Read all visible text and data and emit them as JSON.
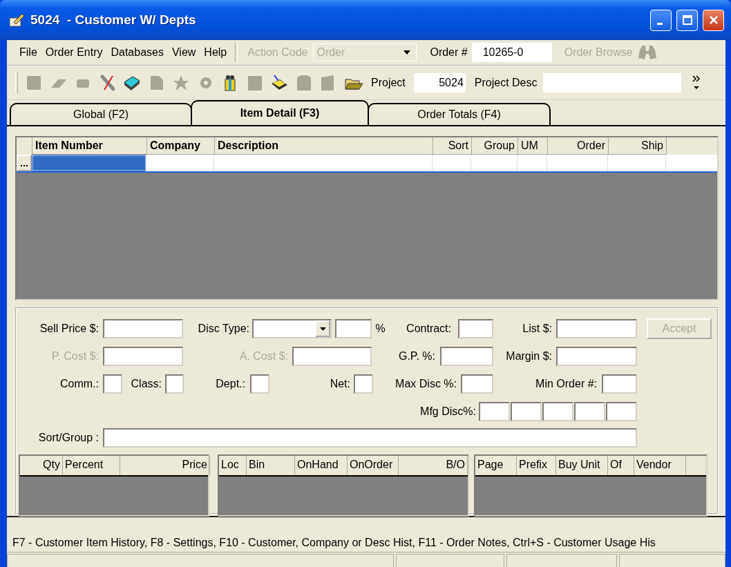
{
  "window": {
    "title": "5024  - Customer W/ Depts"
  },
  "menu": [
    "File",
    "Order Entry",
    "Databases",
    "View",
    "Help"
  ],
  "action_code": {
    "label": "Action Code",
    "value": "Order",
    "disabled": true
  },
  "order_number": {
    "label": "Order #",
    "value": "10265-0"
  },
  "order_browse": {
    "label": "Order Browse",
    "disabled": true
  },
  "toolbar": [
    {
      "disabled": true
    },
    {
      "disabled": true
    },
    {
      "disabled": true
    },
    {
      "disabled": false
    },
    {
      "disabled": false
    },
    {
      "disabled": true
    },
    {
      "disabled": true
    },
    {
      "disabled": true
    },
    {
      "disabled": false
    },
    {
      "disabled": true
    },
    {
      "disabled": false
    },
    {
      "disabled": true
    },
    {
      "disabled": true
    },
    {
      "disabled": false
    }
  ],
  "project": {
    "label": "Project",
    "value": "5024"
  },
  "project_desc": {
    "label": "Project Desc"
  },
  "tabs": [
    {
      "label": "Global (F2)",
      "selected": false
    },
    {
      "label": "Item Detail (F3)",
      "selected": true
    },
    {
      "label": "Order Totals (F4)",
      "selected": false
    }
  ],
  "item_grid": {
    "columns": [
      "Item Number",
      "Company",
      "Description",
      "Sort",
      "Group",
      "UM",
      "Order",
      "Ship"
    ],
    "row_selected": true
  },
  "form": {
    "fields": [
      {
        "kind": "text",
        "label": "Sell Price $:"
      },
      {
        "kind": "combo",
        "label": "Disc Type:"
      },
      {
        "kind": "text",
        "suffix": "%"
      },
      {
        "kind": "text",
        "label": "Contract:"
      },
      {
        "kind": "text",
        "label": "List $:"
      },
      {
        "kind": "button",
        "label": "Accept",
        "disabled": true
      },
      {
        "kind": "text",
        "label": "P. Cost $:",
        "disabled": true
      },
      {
        "kind": "text",
        "label": "A. Cost $:",
        "disabled": true
      },
      {
        "kind": "text",
        "label": "G.P. %:"
      },
      {
        "kind": "text",
        "label": "Margin $:"
      },
      {
        "kind": "text",
        "label": "Comm.:"
      },
      {
        "kind": "text",
        "label": "Class:"
      },
      {
        "kind": "text",
        "label": "Dept.:"
      },
      {
        "kind": "text",
        "label": "Net:"
      },
      {
        "kind": "text",
        "label": "Max Disc %:"
      },
      {
        "kind": "text",
        "label": "Min Order #:"
      },
      {
        "kind": "text",
        "label": "Mfg Disc%:"
      },
      {
        "kind": "text"
      },
      {
        "kind": "text"
      },
      {
        "kind": "text"
      },
      {
        "kind": "text"
      },
      {
        "kind": "text",
        "label": "Sort/Group :"
      }
    ]
  },
  "sub_grids": [
    {
      "columns": [
        "Qty",
        "Percent",
        "Price"
      ]
    },
    {
      "columns": [
        "Loc",
        "Bin",
        "OnHand",
        "OnOrder",
        "B/O"
      ]
    },
    {
      "columns": [
        "Page",
        "Prefix",
        "Buy Unit",
        "Of",
        "Vendor"
      ]
    }
  ],
  "status_bar": {
    "hint": "F7 - Customer Item History, F8 - Settings, F10 - Customer, Company or Desc Hist, F11 - Order Notes, Ctrl+S - Customer Usage His"
  }
}
